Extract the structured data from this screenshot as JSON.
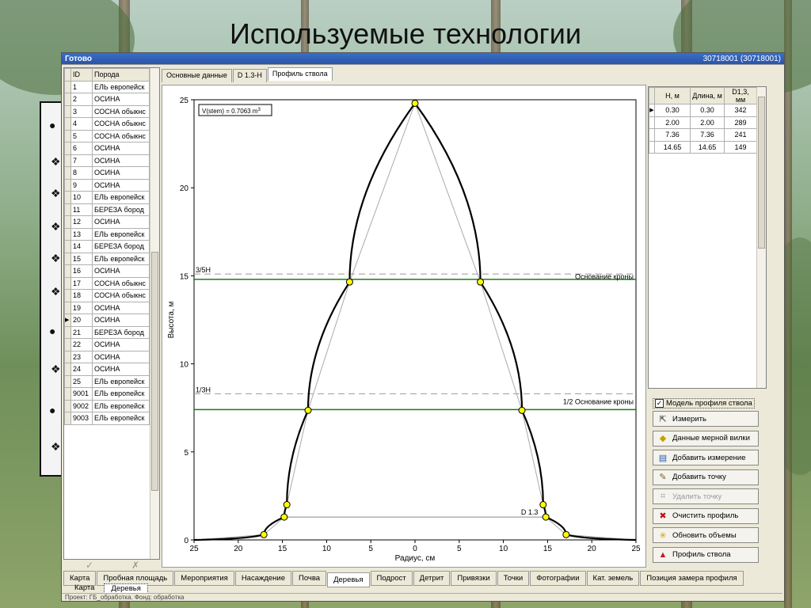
{
  "slide": {
    "title": "Используемые технологии"
  },
  "window": {
    "title_left": "Готово",
    "title_right": "30718001 (30718001)",
    "controls": [
      "_",
      "□",
      "□"
    ]
  },
  "species_list": {
    "headers": [
      "ID",
      "Порода"
    ],
    "rows": [
      {
        "id": "1",
        "name": "ЕЛЬ европейск"
      },
      {
        "id": "2",
        "name": "ОСИНА"
      },
      {
        "id": "3",
        "name": "СОСНА обыкнс"
      },
      {
        "id": "4",
        "name": "СОСНА обыкнс"
      },
      {
        "id": "5",
        "name": "СОСНА обыкнс"
      },
      {
        "id": "6",
        "name": "ОСИНА"
      },
      {
        "id": "7",
        "name": "ОСИНА"
      },
      {
        "id": "8",
        "name": "ОСИНА"
      },
      {
        "id": "9",
        "name": "ОСИНА"
      },
      {
        "id": "10",
        "name": "ЕЛЬ европейск"
      },
      {
        "id": "11",
        "name": "БЕРЕЗА бород"
      },
      {
        "id": "12",
        "name": "ОСИНА"
      },
      {
        "id": "13",
        "name": "ЕЛЬ европейск"
      },
      {
        "id": "14",
        "name": "БЕРЕЗА бород"
      },
      {
        "id": "15",
        "name": "ЕЛЬ европейск"
      },
      {
        "id": "16",
        "name": "ОСИНА"
      },
      {
        "id": "17",
        "name": "СОСНА обыкнс"
      },
      {
        "id": "18",
        "name": "СОСНА обыкнс"
      },
      {
        "id": "19",
        "name": "ОСИНА"
      },
      {
        "id": "20",
        "name": "ОСИНА"
      },
      {
        "id": "21",
        "name": "БЕРЕЗА бород"
      },
      {
        "id": "22",
        "name": "ОСИНА"
      },
      {
        "id": "23",
        "name": "ОСИНА"
      },
      {
        "id": "24",
        "name": "ОСИНА"
      },
      {
        "id": "25",
        "name": "ЕЛЬ европейск"
      },
      {
        "id": "9001",
        "name": "ЕЛЬ европейск"
      },
      {
        "id": "9002",
        "name": "ЕЛЬ европейск"
      },
      {
        "id": "9003",
        "name": "ЕЛЬ европейск"
      }
    ],
    "selected_id": "20"
  },
  "top_tabs": [
    {
      "label": "Основные данные",
      "active": false
    },
    {
      "label": "D 1.3-H",
      "active": false
    },
    {
      "label": "Профиль ствола",
      "active": true
    }
  ],
  "chart_data": {
    "type": "line",
    "xlabel": "Радиус, см",
    "ylabel": "Высота, м",
    "xlim": [
      -25,
      25
    ],
    "ylim": [
      0,
      25
    ],
    "x_ticks": [
      "25",
      "20",
      "15",
      "10",
      "5",
      "0",
      "5",
      "10",
      "15",
      "20",
      "25"
    ],
    "y_ticks": [
      "0",
      "5",
      "10",
      "15",
      "20",
      "25"
    ],
    "annotation": "V(stem) = 0.7063 m",
    "annotation_sup": "3",
    "hlines": [
      {
        "label_left": "3/5H",
        "label_right": "Основание кроны",
        "y_dashed": 15.1,
        "y_green": 14.8
      },
      {
        "label_left": "1/3H",
        "label_right": "1/2 Основание кроны",
        "y_dashed": 8.3,
        "y_green": 7.4
      }
    ],
    "d13_label": "D 1.3",
    "d13_y": 1.3,
    "points": [
      {
        "x": 0,
        "y": 24.8
      },
      {
        "x": -7.4,
        "y": 14.65
      },
      {
        "x": 7.4,
        "y": 14.65
      },
      {
        "x": -12.1,
        "y": 7.36
      },
      {
        "x": 12.1,
        "y": 7.36
      },
      {
        "x": -14.5,
        "y": 2.0
      },
      {
        "x": 14.5,
        "y": 2.0
      },
      {
        "x": -14.8,
        "y": 1.3
      },
      {
        "x": 14.8,
        "y": 1.3
      },
      {
        "x": -17.1,
        "y": 0.3
      },
      {
        "x": 17.1,
        "y": 0.3
      }
    ]
  },
  "measurements": {
    "headers": [
      "Н, м",
      "Длина, м",
      "D1,3, мм"
    ],
    "rows": [
      [
        "0.30",
        "0.30",
        "342"
      ],
      [
        "2.00",
        "2.00",
        "289"
      ],
      [
        "7.36",
        "7.36",
        "241"
      ],
      [
        "14.65",
        "14.65",
        "149"
      ]
    ]
  },
  "model_checkbox": {
    "label": "Модель профиля ствола",
    "checked": "✓"
  },
  "actions": [
    {
      "label": "Измерить",
      "icon": "⇱",
      "enabled": true,
      "name": "measure-button",
      "icon_name": "measure-icon"
    },
    {
      "label": "Данные мерной вилки",
      "icon": "◆",
      "enabled": true,
      "name": "caliper-data-button",
      "icon_name": "caliper-icon"
    },
    {
      "label": "Добавить измерение",
      "icon": "▤",
      "enabled": true,
      "name": "add-measurement-button",
      "icon_name": "table-icon"
    },
    {
      "label": "Добавить точку",
      "icon": "✎",
      "enabled": true,
      "name": "add-point-button",
      "icon_name": "pencil-icon"
    },
    {
      "label": "Удалить точку",
      "icon": "⌗",
      "enabled": false,
      "name": "delete-point-button",
      "icon_name": "delete-point-icon"
    },
    {
      "label": "Очистить профиль",
      "icon": "✖",
      "enabled": true,
      "name": "clear-profile-button",
      "icon_name": "clear-icon"
    },
    {
      "label": "Обновить объемы",
      "icon": "✳",
      "enabled": true,
      "name": "update-volumes-button",
      "icon_name": "refresh-icon"
    },
    {
      "label": "Профиль ствола",
      "icon": "▲",
      "enabled": true,
      "name": "stem-profile-button",
      "icon_name": "profile-icon"
    }
  ],
  "bottom_tabs": [
    {
      "label": "Карта",
      "active": false
    },
    {
      "label": "Пробная площадь",
      "active": false
    },
    {
      "label": "Мероприятия",
      "active": false
    },
    {
      "label": "Насаждение",
      "active": false
    },
    {
      "label": "Почва",
      "active": false
    },
    {
      "label": "Деревья",
      "active": true
    },
    {
      "label": "Подрост",
      "active": false
    },
    {
      "label": "Детрит",
      "active": false
    },
    {
      "label": "Привязки",
      "active": false
    },
    {
      "label": "Точки",
      "active": false
    },
    {
      "label": "Фотографии",
      "active": false
    },
    {
      "label": "Кат. земель",
      "active": false
    },
    {
      "label": "Позиция замера профиля",
      "active": false
    }
  ],
  "sub_tabs": [
    {
      "label": "Карта",
      "active": false
    },
    {
      "label": "Деревья",
      "active": true
    }
  ],
  "status_text": "Проект: ГБ_обработка. Фонд: обработка"
}
